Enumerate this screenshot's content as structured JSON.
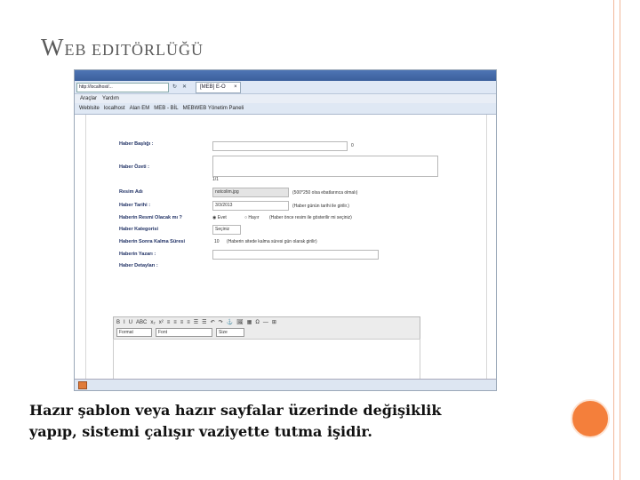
{
  "slide": {
    "title_first": "W",
    "title_rest_big": "EB",
    "title_rest_small": " EDITÖRLÜĞÜ",
    "caption_line1": "Hazır şablon veya hazır sayfalar üzerinde değişiklik",
    "caption_line2": "yapıp, sistemi çalışır vaziyette tutma işidir.",
    "accent_color": "#f47f3b"
  },
  "browser": {
    "address": "http://localhost/...",
    "tab_label": "[MEB] E-O",
    "menu": [
      "Araçlar",
      "Yardım"
    ],
    "favorites": [
      "Weblsite",
      "localhost",
      "Alan EM",
      "MEB - BİL",
      "MEBWEB Yönetim Paneli"
    ]
  },
  "form": {
    "labels": [
      "Haber Başlığı :",
      "Haber Özeti :",
      "Resim Adı",
      "Haber Tarihi :",
      "Haberin Resmi Olacak mı ?",
      "Haber Kategorisi",
      "Haberin Sonra Kalma Süresi",
      "Haberin Yazarı :",
      "Haber Detayları :"
    ],
    "char_count_1": "0",
    "char_count_2": "1/1",
    "image_value": "notcolim.jpg",
    "image_hint": "(500*250 olsa ebatlarınca olmalı)",
    "date_value": "3/3/2013",
    "date_hint": "(Haber günün tarihi ile girilir.)",
    "radio_yes": "Evet",
    "radio_no": "Hayır",
    "radio_hint": "(Haber önce resim ile gösterilir mi seçiniz)",
    "category_value": "Seçiniz",
    "duration_value": "10",
    "duration_hint": "(Haberin sitede kalma süresi gün olarak girilir)",
    "editor_row1": [
      "B",
      "I",
      "U",
      "ABC",
      "x₂",
      "x²",
      "≡",
      "≡",
      "≡",
      "≡",
      "☰",
      "☰",
      "↶",
      "↷",
      "⚓",
      "🖼",
      "▦",
      "Ω",
      "—",
      "⊞"
    ],
    "format_label": "Format",
    "font_label": "Font",
    "size_label": "Size"
  }
}
